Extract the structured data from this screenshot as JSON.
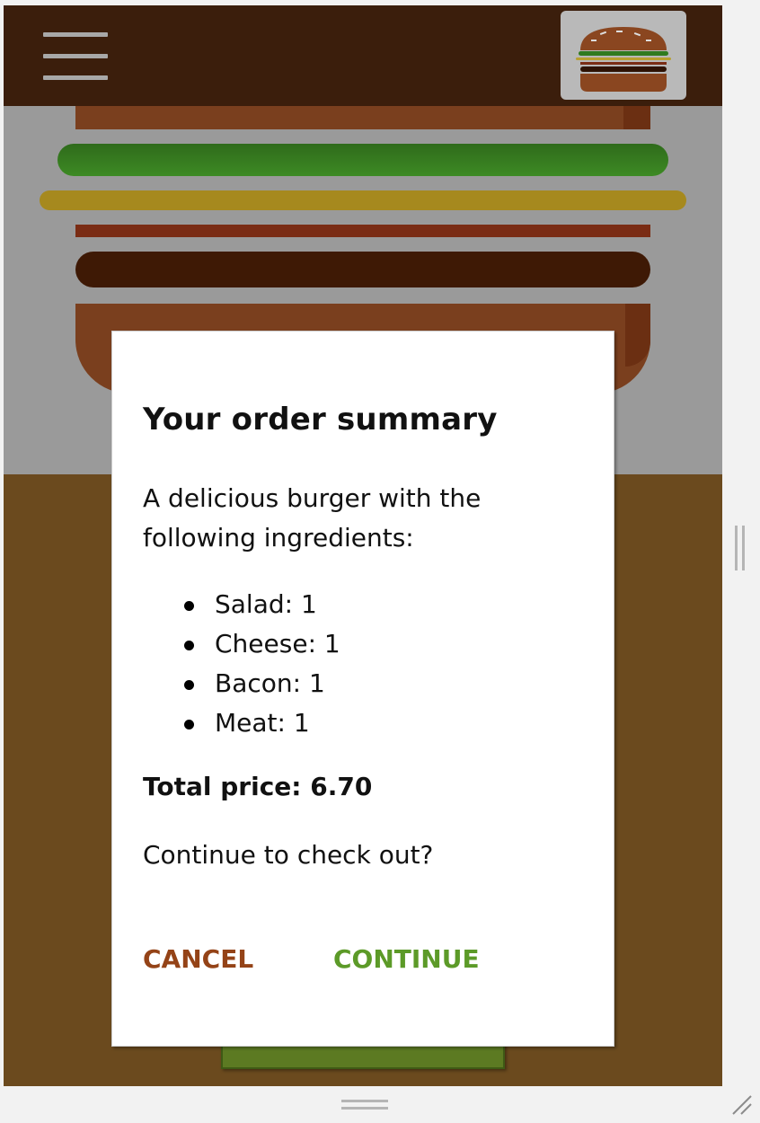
{
  "toolbar": {
    "menu_icon": "hamburger-menu-icon",
    "logo_icon": "burger-logo-icon"
  },
  "burger_preview": {
    "layers": [
      "bread-top",
      "salad",
      "cheese",
      "bacon",
      "meat",
      "bread-bottom"
    ]
  },
  "modal": {
    "title": "Your order summary",
    "description": "A delicious burger with the following ingredients:",
    "ingredients": [
      {
        "label": "Salad: 1"
      },
      {
        "label": "Cheese: 1"
      },
      {
        "label": "Bacon: 1"
      },
      {
        "label": "Meat: 1"
      }
    ],
    "total": "Total price: 6.70",
    "question": "Continue to check out?",
    "cancel_label": "CANCEL",
    "continue_label": "CONTINUE"
  },
  "colors": {
    "toolbar_bg": "#3b1e0c",
    "cancel": "#944317",
    "continue": "#5c9a28",
    "page_bg": "#6b4a1e"
  }
}
